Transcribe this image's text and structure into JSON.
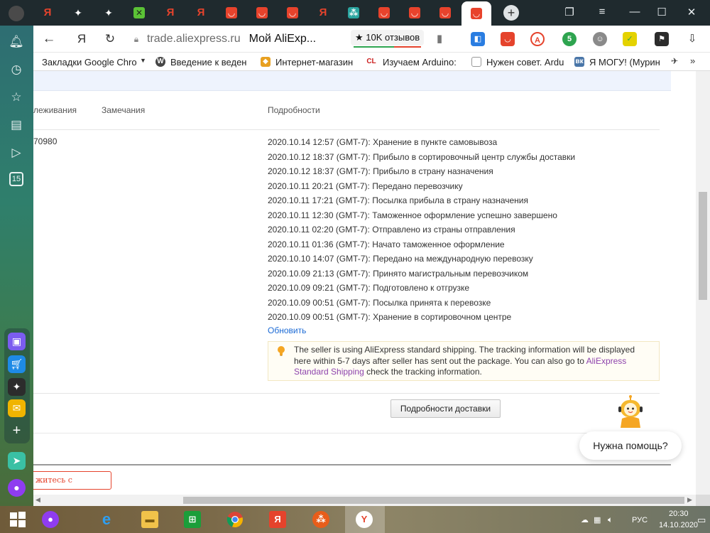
{
  "browser": {
    "address": {
      "domain": "trade.aliexpress.ru",
      "page_title": "Мой AliExp...",
      "reviews": "★ 10K отзывов"
    },
    "tabs": [
      {
        "icon": "yandex-icon",
        "glyph": "Я"
      },
      {
        "icon": "sparkle-icon",
        "glyph": "✦"
      },
      {
        "icon": "sparkle-icon",
        "glyph": "✦"
      },
      {
        "icon": "game-icon",
        "glyph": "✕"
      },
      {
        "icon": "yandex-icon",
        "glyph": "Я"
      },
      {
        "icon": "yandex-icon",
        "glyph": "Я"
      },
      {
        "icon": "aliexpress-icon",
        "glyph": "◡"
      },
      {
        "icon": "aliexpress-icon",
        "glyph": "◡"
      },
      {
        "icon": "aliexpress-icon",
        "glyph": "◡"
      },
      {
        "icon": "yandex-icon",
        "glyph": "Я"
      },
      {
        "icon": "share-icon",
        "glyph": "⁂"
      },
      {
        "icon": "aliexpress-icon",
        "glyph": "◡"
      },
      {
        "icon": "aliexpress-icon",
        "glyph": "◡"
      },
      {
        "icon": "aliexpress-icon",
        "glyph": "◡"
      },
      {
        "icon": "aliexpress-icon",
        "glyph": "◡"
      }
    ],
    "bookmarks": [
      {
        "label": "Закладки Google Chro",
        "icon": "folder-icon"
      },
      {
        "label": "Введение к веден",
        "icon": "wordpress-icon"
      },
      {
        "label": "Интернет-магазин",
        "icon": "shop-icon"
      },
      {
        "label": "Изучаем Arduino:",
        "icon": "cl-icon"
      },
      {
        "label": "Нужен совет. Ardu",
        "icon": "page-icon"
      },
      {
        "label": "Я МОГУ! (Мурин",
        "icon": "vk-icon"
      }
    ]
  },
  "tracking": {
    "headers": {
      "tracking": "леживания",
      "notes": "Замечания",
      "details": "Подробности"
    },
    "number": "70980",
    "events": [
      "2020.10.14 12:57 (GMT-7): Хранение в пункте самовывоза",
      "2020.10.12 18:37 (GMT-7): Прибыло в сортировочный центр службы доставки",
      "2020.10.12 18:37 (GMT-7): Прибыло в страну назначения",
      "2020.10.11 20:21 (GMT-7): Передано перевозчику",
      "2020.10.11 17:21 (GMT-7): Посылка прибыла в страну назначения",
      "2020.10.11 12:30 (GMT-7): Таможенное оформление успешно завершено",
      "2020.10.11 02:20 (GMT-7): Отправлено из страны отправления",
      "2020.10.11 01:36 (GMT-7): Начато таможенное оформление",
      "2020.10.10 14:07 (GMT-7): Передано на международную перевозку",
      "2020.10.09 21:13 (GMT-7): Принято магистральным перевозчиком",
      "2020.10.09 09:21 (GMT-7): Подготовлено к отгрузке",
      "2020.10.09 00:51 (GMT-7): Посылка принята к перевозке",
      "2020.10.09 00:51 (GMT-7): Хранение в сортировочном центре"
    ],
    "refresh": "Обновить",
    "note_before": "The seller is using AliExpress standard shipping. The tracking information will be displayed here within 5-7 days after seller has sent out the package. You can also go to ",
    "note_link": "AliExpress Standard Shipping",
    "note_after": " check the tracking information.",
    "delivery_button": "Подробности доставки",
    "contact_button": "житесь с продавцом"
  },
  "help": {
    "bubble": "Нужна помощь?"
  },
  "sidebar": {
    "badge": "15"
  },
  "taskbar": {
    "time": "20:30",
    "date": "14.10.2020",
    "lang": "РУС"
  },
  "colors": {
    "accent_red": "#e5432c",
    "link_blue": "#1b6ad5",
    "link_purple": "#8e44ad",
    "note_bg": "#fffdf5"
  }
}
